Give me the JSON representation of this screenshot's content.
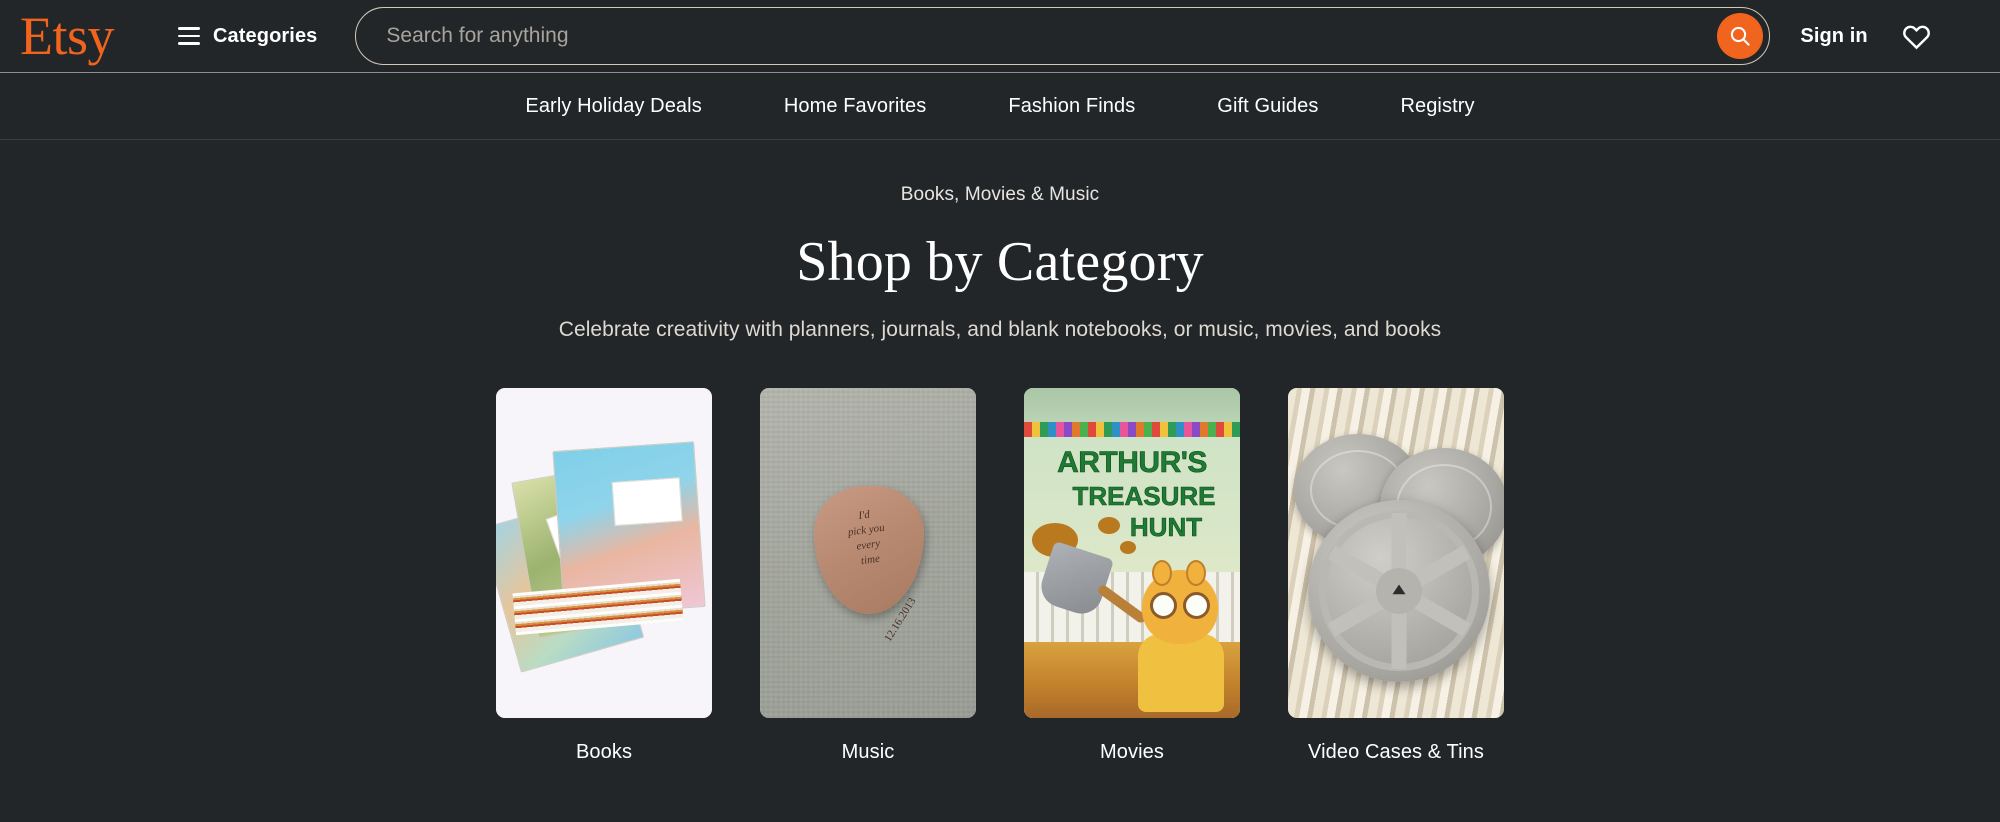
{
  "brand": {
    "logo_text": "Etsy",
    "logo_color": "#F1641E"
  },
  "header": {
    "categories_label": "Categories",
    "search": {
      "placeholder": "Search for anything",
      "value": ""
    },
    "sign_in_label": "Sign in"
  },
  "subnav": {
    "items": [
      {
        "label": "Early Holiday Deals"
      },
      {
        "label": "Home Favorites"
      },
      {
        "label": "Fashion Finds"
      },
      {
        "label": "Gift Guides"
      },
      {
        "label": "Registry"
      }
    ]
  },
  "main": {
    "breadcrumb": "Books, Movies & Music",
    "title": "Shop by Category",
    "subtitle": "Celebrate creativity with planners, journals, and blank notebooks, or music, movies, and books",
    "cards": [
      {
        "label": "Books"
      },
      {
        "label": "Music"
      },
      {
        "label": "Movies"
      },
      {
        "label": "Video Cases & Tins"
      }
    ]
  },
  "artwork": {
    "music_pick_line1": "I'd",
    "music_pick_line2": "pick you",
    "music_pick_line3": "every",
    "music_pick_line4": "time",
    "music_pick_date": "12.16.2013",
    "movies_title_line1": "ARTHUR'S",
    "movies_title_line2": "TREASURE",
    "movies_title_line3": "HUNT"
  },
  "colors": {
    "background": "#222629",
    "accent_orange": "#F1641E",
    "search_border": "#d2c8b8",
    "text_primary": "#ffffff"
  }
}
